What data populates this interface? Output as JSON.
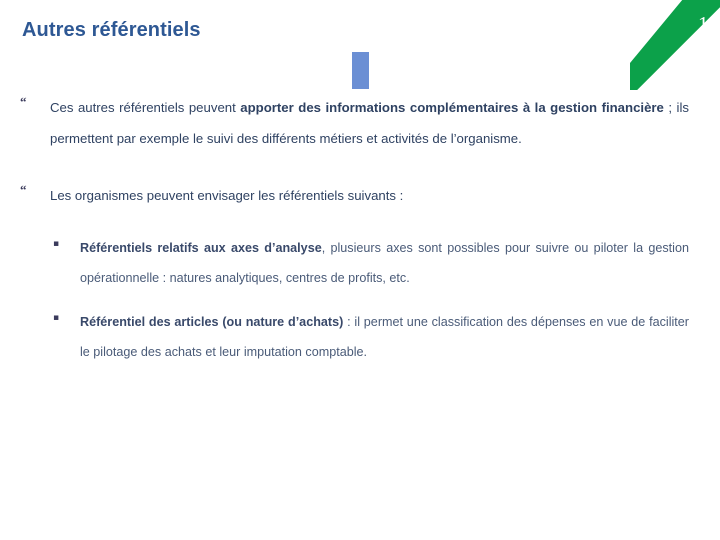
{
  "slide": {
    "title": "Autres référentiels",
    "number": "1",
    "accent_green": "#0CA14A",
    "accent_blue": "#6B8FD4",
    "title_color": "#2E5894",
    "body_color": "#2F4262",
    "subbody_color": "#4A5B78",
    "background": "#ffffff"
  },
  "bullets": [
    {
      "marker": "“",
      "level": 1,
      "runs": [
        {
          "text": "Ces autres référentiels peuvent ",
          "bold": false
        },
        {
          "text": "apporter des informations complémentaires à la gestion financière",
          "bold": true
        },
        {
          "text": " ; ils permettent par exemple le suivi des différents métiers et activités de l’organisme.",
          "bold": false
        }
      ]
    },
    {
      "marker": "“",
      "level": 1,
      "runs": [
        {
          "text": "Les organismes peuvent envisager les référentiels suivants :",
          "bold": false
        }
      ]
    },
    {
      "marker": "▪",
      "level": 2,
      "runs": [
        {
          "text": "Référentiels relatifs aux axes d’analyse",
          "bold": true
        },
        {
          "text": ", plusieurs axes sont possibles pour suivre ou piloter la gestion opérationnelle : natures analytiques, centres de profits, etc.",
          "bold": false
        }
      ]
    },
    {
      "marker": "▪",
      "level": 2,
      "runs": [
        {
          "text": "Référentiel des articles (ou nature d’achats)",
          "bold": true
        },
        {
          "text": " : il permet une classification des dépenses en vue de faciliter le pilotage des achats et leur imputation comptable.",
          "bold": false
        }
      ]
    }
  ]
}
